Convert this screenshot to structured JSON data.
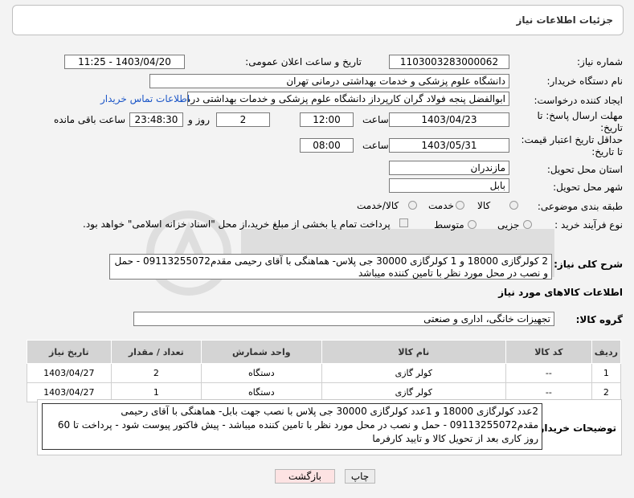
{
  "header": {
    "title": "جزئیات اطلاعات نیاز"
  },
  "need_number": {
    "label": "شماره نیاز:",
    "value": "1103003283000062"
  },
  "announce": {
    "label": "تاریخ و ساعت اعلان عمومی:",
    "value": "1403/04/20 - 11:25"
  },
  "buyer_org": {
    "label": "نام دستگاه خریدار:",
    "value": "دانشگاه علوم پزشکی و خدمات بهداشتی درمانی تهران"
  },
  "creator": {
    "label": "ایجاد کننده درخواست:",
    "value": "ابوالفضل  پنجه فولاد گران  کارپرداز دانشگاه علوم پزشکی و خدمات بهداشتی درمانی تهران",
    "contact_link": "اطلاعات تماس خریدار"
  },
  "deadline": {
    "label": "مهلت ارسال پاسخ: تا تاریخ:",
    "date": "1403/04/23",
    "time_label": "ساعت",
    "time": "12:00",
    "days": "2",
    "days_label": "روز و",
    "remaining": "23:48:30",
    "remaining_label": "ساعت باقی مانده"
  },
  "validity": {
    "label": "حداقل تاریخ اعتبار قیمت: تا تاریخ:",
    "date": "1403/05/31",
    "time_label": "ساعت",
    "time": "08:00"
  },
  "province": {
    "label": "استان محل تحویل:",
    "value": "مازندران"
  },
  "city": {
    "label": "شهر محل تحویل:",
    "value": "بابل"
  },
  "category": {
    "label": "طبقه بندی موضوعی:",
    "options": [
      "کالا",
      "خدمت",
      "کالا/خدمت"
    ]
  },
  "process": {
    "label": "نوع فرآیند خرید :",
    "options": [
      "جزیی",
      "متوسط"
    ],
    "note": "پرداخت تمام یا بخشی از مبلغ خرید،از محل \"اسناد خزانه اسلامی\" خواهد بود."
  },
  "description": {
    "label": "شرح کلی نیاز:",
    "value": "2 کولرگازی 18000 و 1 کولرگازی 30000 جی پلاس- هماهنگی با آقای رحیمی مقدم09113255072 - حمل و نصب در محل مورد نظر با تامین کننده میباشد"
  },
  "goods_info": {
    "title": "اطلاعات کالاهای مورد نیاز"
  },
  "goods_group": {
    "label": "گروه کالا:",
    "value": "تجهیزات خانگی، اداری و صنعتی"
  },
  "table": {
    "headers": [
      "ردیف",
      "کد کالا",
      "نام کالا",
      "واحد شمارش",
      "تعداد / مقدار",
      "تاریخ نیاز"
    ],
    "rows": [
      [
        "1",
        "--",
        "کولر گازی",
        "دستگاه",
        "2",
        "1403/04/27"
      ],
      [
        "2",
        "--",
        "کولر گازی",
        "دستگاه",
        "1",
        "1403/04/27"
      ]
    ]
  },
  "buyer_notes": {
    "label": "توضیحات خریدار:",
    "value": "2عدد کولرگازی 18000 و 1عدد کولرگازی 30000 جی پلاس با نصب جهت بابل- هماهنگی با آقای رحیمی مقدم09113255072 - حمل و نصب در محل مورد نظر با تامین کننده میباشد - پیش فاکتور پیوست شود - پرداخت تا 60 روز کاری بعد از تحویل کالا و تایید کارفرما"
  },
  "buttons": {
    "print": "چاپ",
    "back": "بازگشت"
  },
  "colors": {
    "link": "#1a55c7",
    "back_button_bg": "#fde3e3",
    "table_header": "#d4d4d4"
  }
}
